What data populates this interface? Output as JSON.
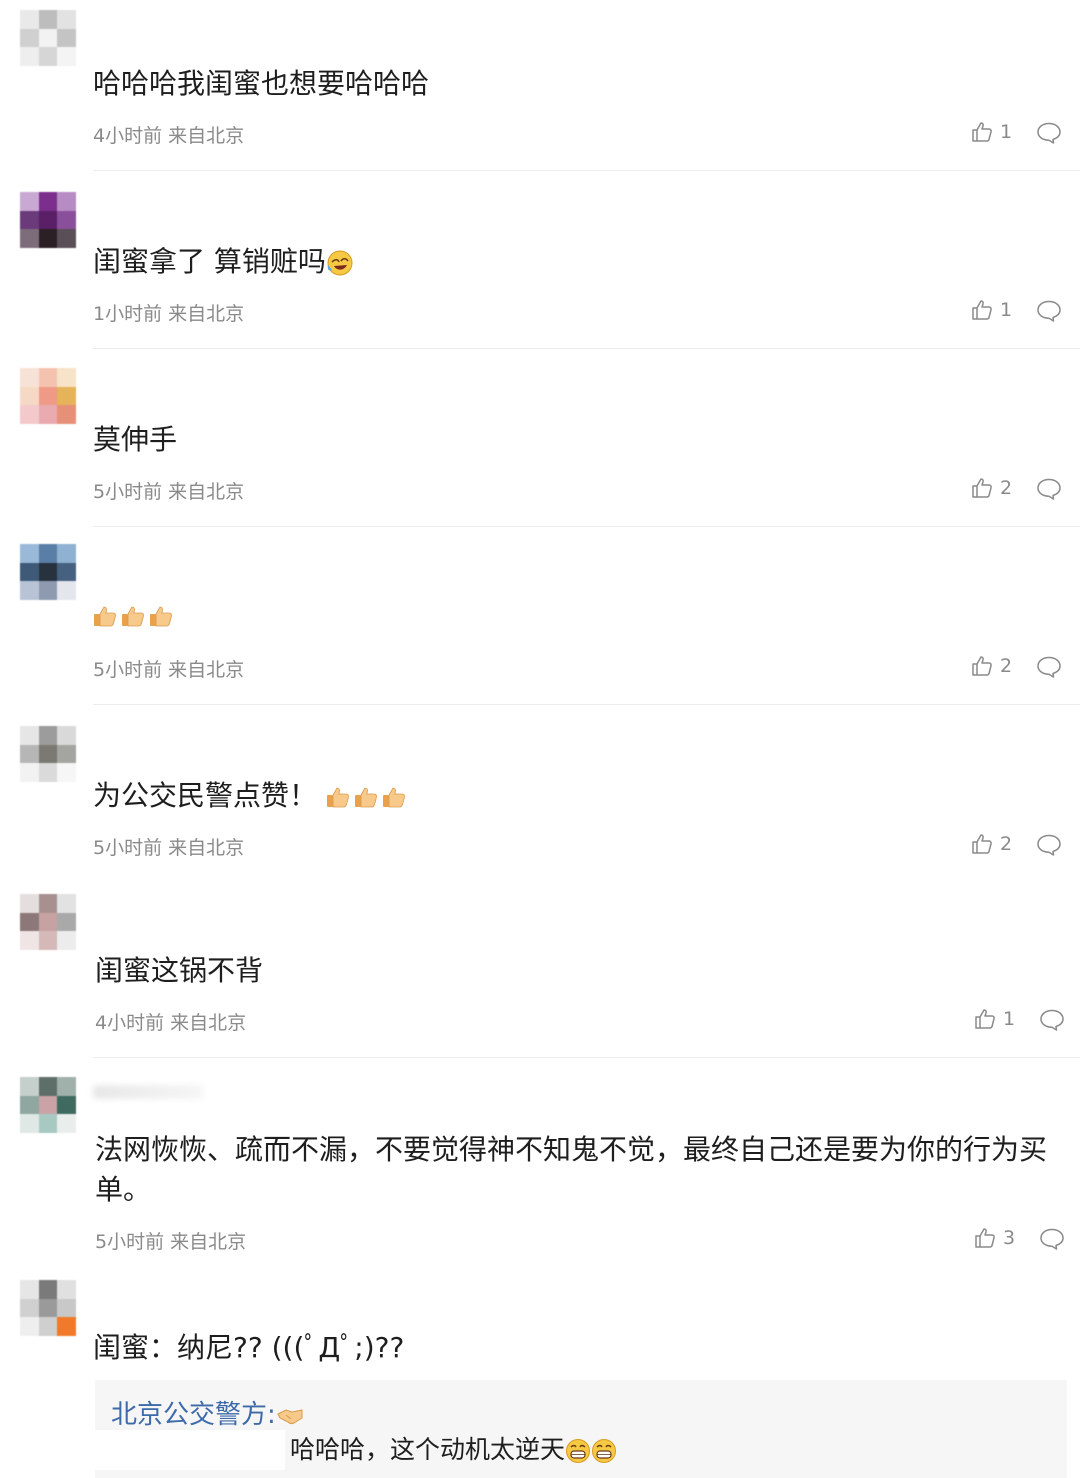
{
  "comments": [
    {
      "text": "哈哈哈我闺蜜也想要哈哈哈",
      "meta": "4小时前 来自北京",
      "likes": "1"
    },
    {
      "text": "闺蜜拿了 算销赃吗",
      "meta": "1小时前 来自北京",
      "likes": "1"
    },
    {
      "text": "莫伸手",
      "meta": "5小时前 来自北京",
      "likes": "2"
    },
    {
      "text": "",
      "meta": "5小时前 来自北京",
      "likes": "2"
    },
    {
      "text": "为公交民警点赞！",
      "meta": "5小时前 来自北京",
      "likes": "2"
    },
    {
      "text": "闺蜜这锅不背",
      "meta": "4小时前 来自北京",
      "likes": "1"
    },
    {
      "text": "法网恢恢、疏而不漏，不要觉得神不知鬼不觉，最终自己还是要为你的行为买单。",
      "meta": "5小时前 来自北京",
      "likes": "3"
    },
    {
      "text": "闺蜜：纳尼?? (((ﾟДﾟ;)??"
    }
  ],
  "reply": {
    "author": "北京公交警方:",
    "text": "哈哈哈，这个动机太逆天"
  },
  "icons": {
    "like": "thumbs-up-outline-icon",
    "comment": "speech-bubble-icon",
    "emoji_thumb": "thumbs-up-emoji",
    "emoji_laugh": "laughing-crying-emoji",
    "emoji_grin": "grinning-emoji",
    "emoji_handshake": "handshake-emoji"
  },
  "colors": {
    "meta": "#8a8a8a",
    "reply_author": "#3d6aa8",
    "reply_bg": "#f6f6f6"
  }
}
